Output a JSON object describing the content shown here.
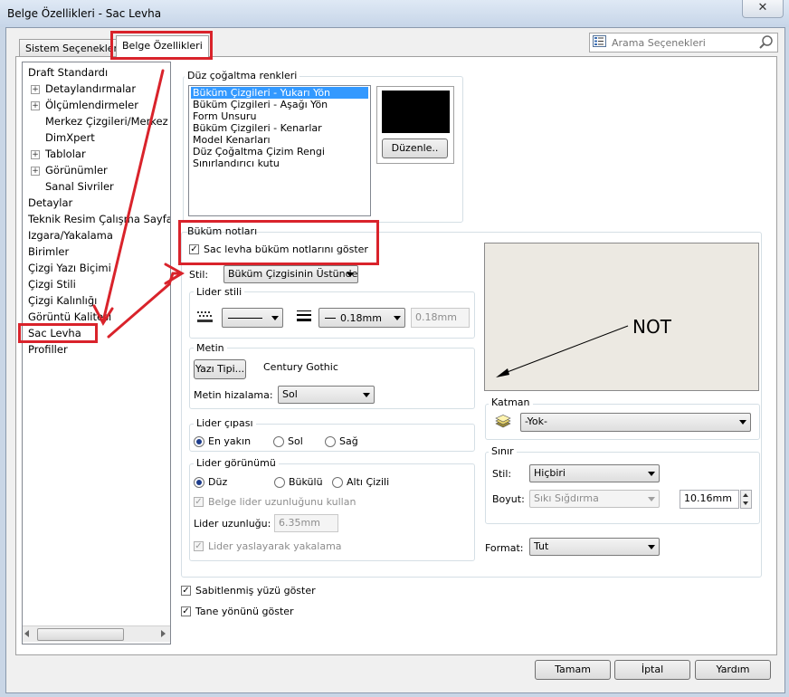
{
  "window": {
    "title": "Belge Özellikleri - Sac Levha",
    "close_glyph": "✕"
  },
  "tabs": [
    {
      "label": "Sistem Seçenekleri"
    },
    {
      "label": "Belge Özellikleri"
    }
  ],
  "search": {
    "placeholder": "Arama Seçenekleri"
  },
  "tree": {
    "items": [
      {
        "label": "Draft Standardı"
      },
      {
        "label": "Detaylandırmalar"
      },
      {
        "label": "Ölçümlendirmeler"
      },
      {
        "label": "Merkez Çizgileri/Merkez İş"
      },
      {
        "label": "DimXpert"
      },
      {
        "label": "Tablolar"
      },
      {
        "label": "Görünümler"
      },
      {
        "label": "Sanal Sivriler"
      },
      {
        "label": "Detaylar"
      },
      {
        "label": "Teknik Resim Çalışma Sayfası"
      },
      {
        "label": "Izgara/Yakalama"
      },
      {
        "label": "Birimler"
      },
      {
        "label": "Çizgi Yazı Biçimi"
      },
      {
        "label": "Çizgi Stili"
      },
      {
        "label": "Çizgi Kalınlığı"
      },
      {
        "label": "Görüntü Kalitesi"
      },
      {
        "label": "Sac Levha"
      },
      {
        "label": "Profiller"
      }
    ]
  },
  "colors": {
    "title": "Düz çoğaltma renkleri",
    "items": [
      "Büküm Çizgileri - Yukarı Yön",
      "Büküm Çizgileri - Aşağı Yön",
      "Form Unsuru",
      "Büküm Çizgileri - Kenarlar",
      "Model Kenarları",
      "Düz Çoğaltma Çizim Rengi",
      "Sınırlandırıcı kutu"
    ],
    "swatch_color": "#000000",
    "edit_button": "Düzenle.."
  },
  "bend_notes": {
    "title": "Büküm notları",
    "show_label": "Sac levha büküm notlarını göster",
    "style_label": "Stil:",
    "style_value": "Büküm Çizgisinin Üstünde"
  },
  "leader_style": {
    "title": "Lider stili",
    "thickness_value": "0.18mm",
    "thickness_custom": "0.18mm"
  },
  "text": {
    "title": "Metin",
    "font_button": "Yazı Tipi...",
    "font_name": "Century Gothic",
    "align_label": "Metin hizalama:",
    "align_value": "Sol"
  },
  "anchor": {
    "title": "Lider çıpası",
    "options": [
      {
        "label": "En yakın"
      },
      {
        "label": "Sol"
      },
      {
        "label": "Sağ"
      }
    ]
  },
  "leader_display": {
    "title": "Lider görünümü",
    "options": [
      {
        "label": "Düz"
      },
      {
        "label": "Bükülü"
      },
      {
        "label": "Altı Çizili"
      }
    ],
    "use_doc_length": "Belge lider uzunluğunu kullan",
    "length_label": "Lider uzunluğu:",
    "length_value": "6.35mm",
    "snap_label": "Lider yaslayarak yakalama"
  },
  "preview": {
    "note_text": "NOT"
  },
  "layer": {
    "title": "Katman",
    "value": "-Yok-"
  },
  "border": {
    "title": "Sınır",
    "style_label": "Stil:",
    "style_value": "Hiçbiri",
    "size_label": "Boyut:",
    "size_value": "Sıkı Sığdırma",
    "size_num": "10.16mm"
  },
  "format": {
    "label": "Format:",
    "value": "Tut"
  },
  "options": {
    "show_fixed_face": "Sabitlenmiş yüzü göster",
    "show_grain": "Tane yönünü göster"
  },
  "buttons": {
    "ok": "Tamam",
    "cancel": "İptal",
    "help": "Yardım"
  }
}
